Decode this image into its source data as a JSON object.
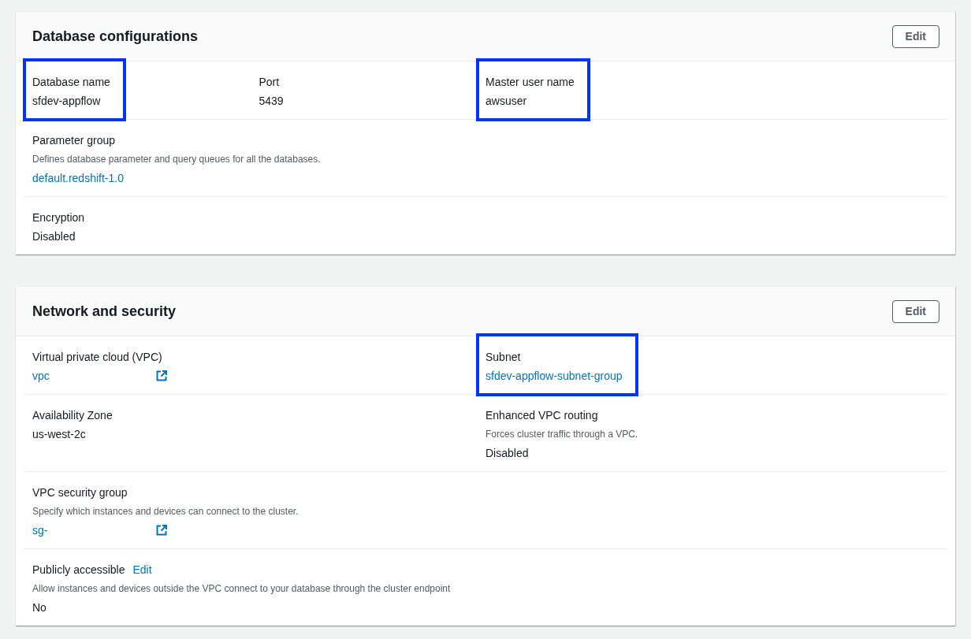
{
  "sections": [
    {
      "title": "Database configurations",
      "edit_button": "Edit",
      "rows": [
        {
          "cells": [
            {
              "label": "Database name",
              "value": "sfdev-appflow",
              "link": false,
              "external_link": false,
              "highlighted": true
            },
            {
              "label": "Port",
              "value": "5439",
              "link": false,
              "external_link": false,
              "highlighted": false
            },
            {
              "label": "Master user name",
              "value": "awsuser",
              "link": false,
              "external_link": false,
              "highlighted": true
            }
          ]
        },
        {
          "cells": [
            {
              "label": "Parameter group",
              "description": "Defines database parameter and query queues for all the databases.",
              "value": "default.redshift-1.0",
              "link": true,
              "external_link": false,
              "highlighted": false
            }
          ]
        },
        {
          "cells": [
            {
              "label": "Encryption",
              "value": "Disabled",
              "link": false,
              "external_link": false,
              "highlighted": false
            }
          ]
        }
      ]
    },
    {
      "title": "Network and security",
      "edit_button": "Edit",
      "rows": [
        {
          "cells": [
            {
              "label": "Virtual private cloud (VPC)",
              "value": "vpc",
              "link": true,
              "external_link": true,
              "highlighted": false
            },
            {
              "label": "Subnet",
              "value": "sfdev-appflow-subnet-group",
              "link": true,
              "external_link": false,
              "highlighted": true
            }
          ]
        },
        {
          "cells": [
            {
              "label": "Availability Zone",
              "value": "us-west-2c",
              "link": false,
              "external_link": false,
              "highlighted": false
            },
            {
              "label": "Enhanced VPC routing",
              "description": "Forces cluster traffic through a VPC.",
              "value": "Disabled",
              "link": false,
              "external_link": false,
              "highlighted": false
            }
          ]
        },
        {
          "cells": [
            {
              "label": "VPC security group",
              "description": "Specify which instances and devices can connect to the cluster.",
              "value": "sg-",
              "link": true,
              "external_link": true,
              "highlighted": false
            }
          ]
        },
        {
          "cells": [
            {
              "label": "Publicly accessible",
              "label_link": "Edit",
              "description": "Allow instances and devices outside the VPC connect to your database through the cluster endpoint",
              "value": "No",
              "link": false,
              "external_link": false,
              "highlighted": false
            }
          ]
        }
      ]
    }
  ]
}
